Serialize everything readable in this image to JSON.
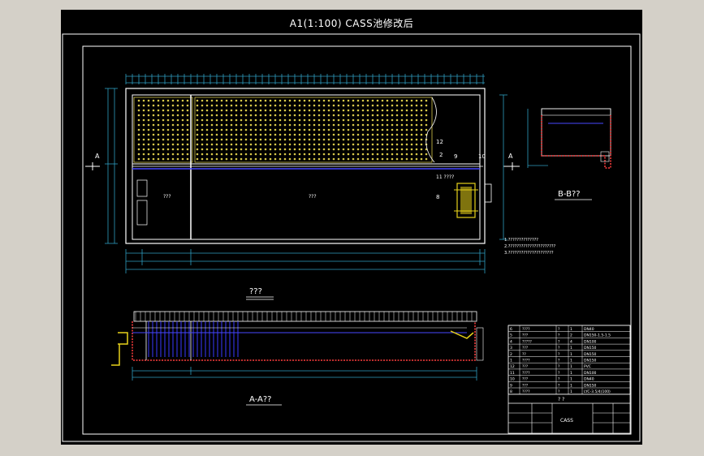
{
  "sheet_title": "A1(1:100) CASS池修改后",
  "plan_view": {
    "caption": "???",
    "markers": [
      "A",
      "A"
    ],
    "tags": [
      "2",
      "9",
      "10",
      "11",
      "12",
      "8"
    ],
    "zone_text_left": "???",
    "zone_text_main": "???",
    "callout": "11  ????"
  },
  "section_bb": {
    "caption": "B-B??"
  },
  "section_aa": {
    "caption": "A-A??"
  },
  "notes": [
    "1.??????????????",
    "2.??????????????????????",
    "3.?????????????????????"
  ],
  "title_block": {
    "rows": [
      [
        "6",
        "????",
        "?",
        "1",
        "DN40"
      ],
      [
        "5",
        "???",
        "?",
        "2",
        "DN150-1.5-1.5"
      ],
      [
        "4",
        "?????",
        "?",
        "4",
        "DN100"
      ],
      [
        "3",
        "???",
        "?",
        "1",
        "DN150"
      ],
      [
        "2",
        "??",
        "?",
        "1",
        "DN150"
      ],
      [
        "1",
        "????",
        "?",
        "1",
        "DN150"
      ],
      [
        "12",
        "???",
        "?",
        "1",
        "PVC"
      ],
      [
        "11",
        "????",
        "?",
        "1",
        "DN100"
      ],
      [
        "10",
        "???",
        "?",
        "1",
        "DN40"
      ],
      [
        "9",
        "???",
        "?",
        "1",
        "DN150"
      ],
      [
        "8",
        "????",
        "?",
        "1",
        "LYC-3.5/4(100)"
      ]
    ],
    "header": "?  ?",
    "drawing_name": "CASS"
  }
}
